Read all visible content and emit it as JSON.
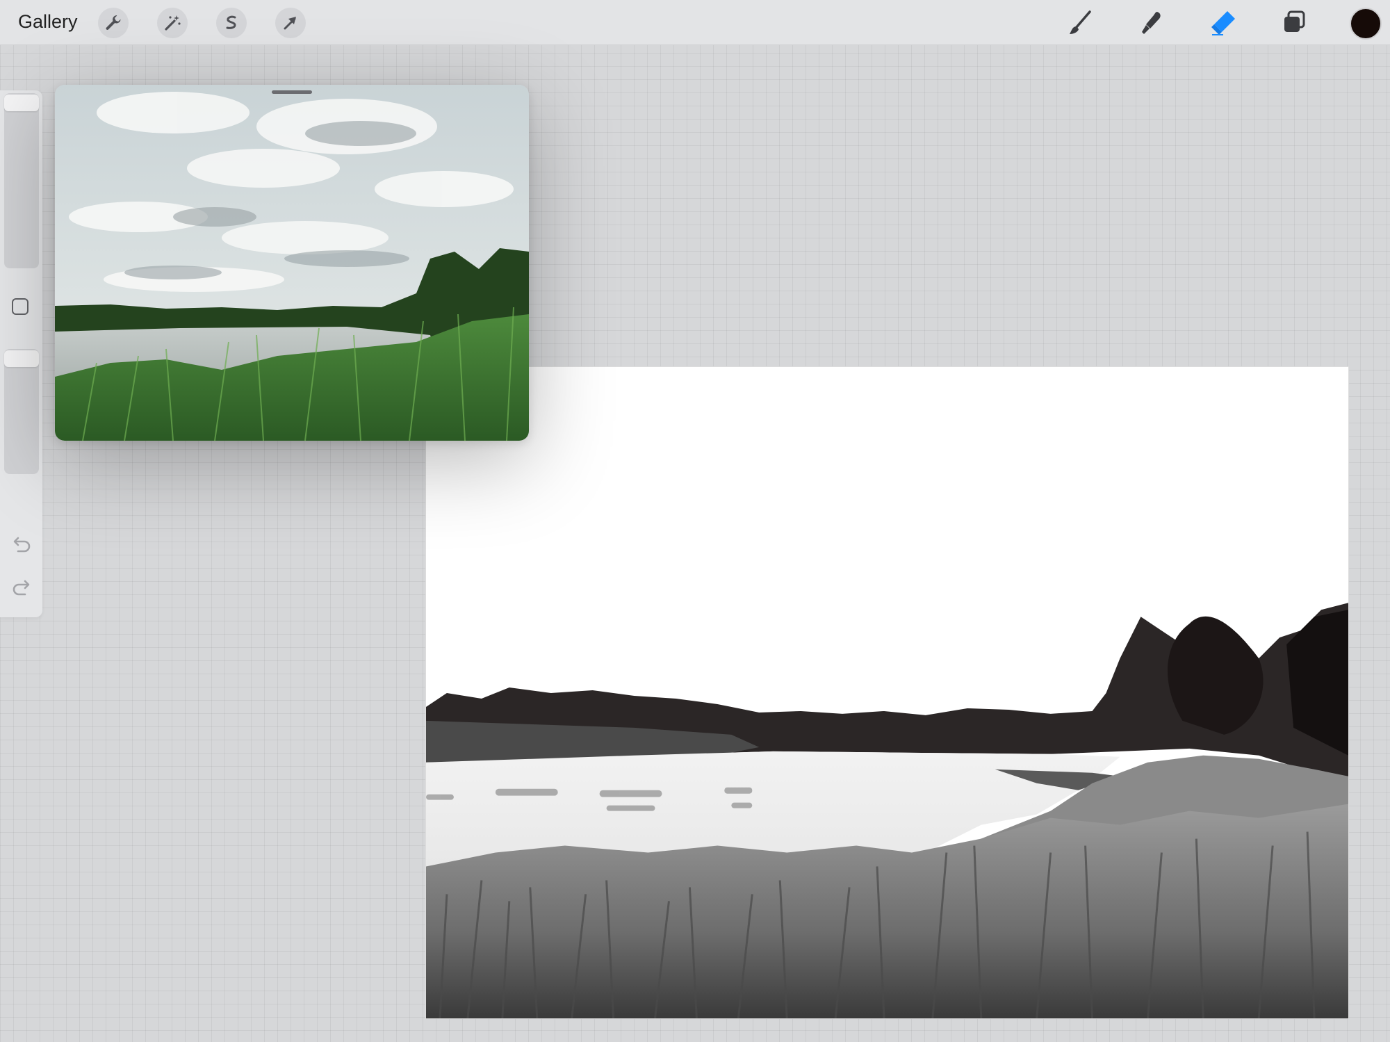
{
  "topbar": {
    "gallery_label": "Gallery",
    "left_tools": [
      "wrench-icon",
      "magic-wand-icon",
      "selection-icon",
      "transform-arrow-icon"
    ],
    "right_tools": [
      "brush-icon",
      "smudge-icon",
      "eraser-icon",
      "layers-icon"
    ],
    "active_tool": "eraser-icon",
    "accent_color": "#1a8cff",
    "current_color": "#160b08"
  },
  "sidebar": {
    "controls": [
      "brush-size-slider",
      "modify-button",
      "opacity-slider",
      "undo-arrow-icon",
      "redo-arrow-icon"
    ]
  },
  "reference": {
    "window": "reference-photo-window"
  }
}
